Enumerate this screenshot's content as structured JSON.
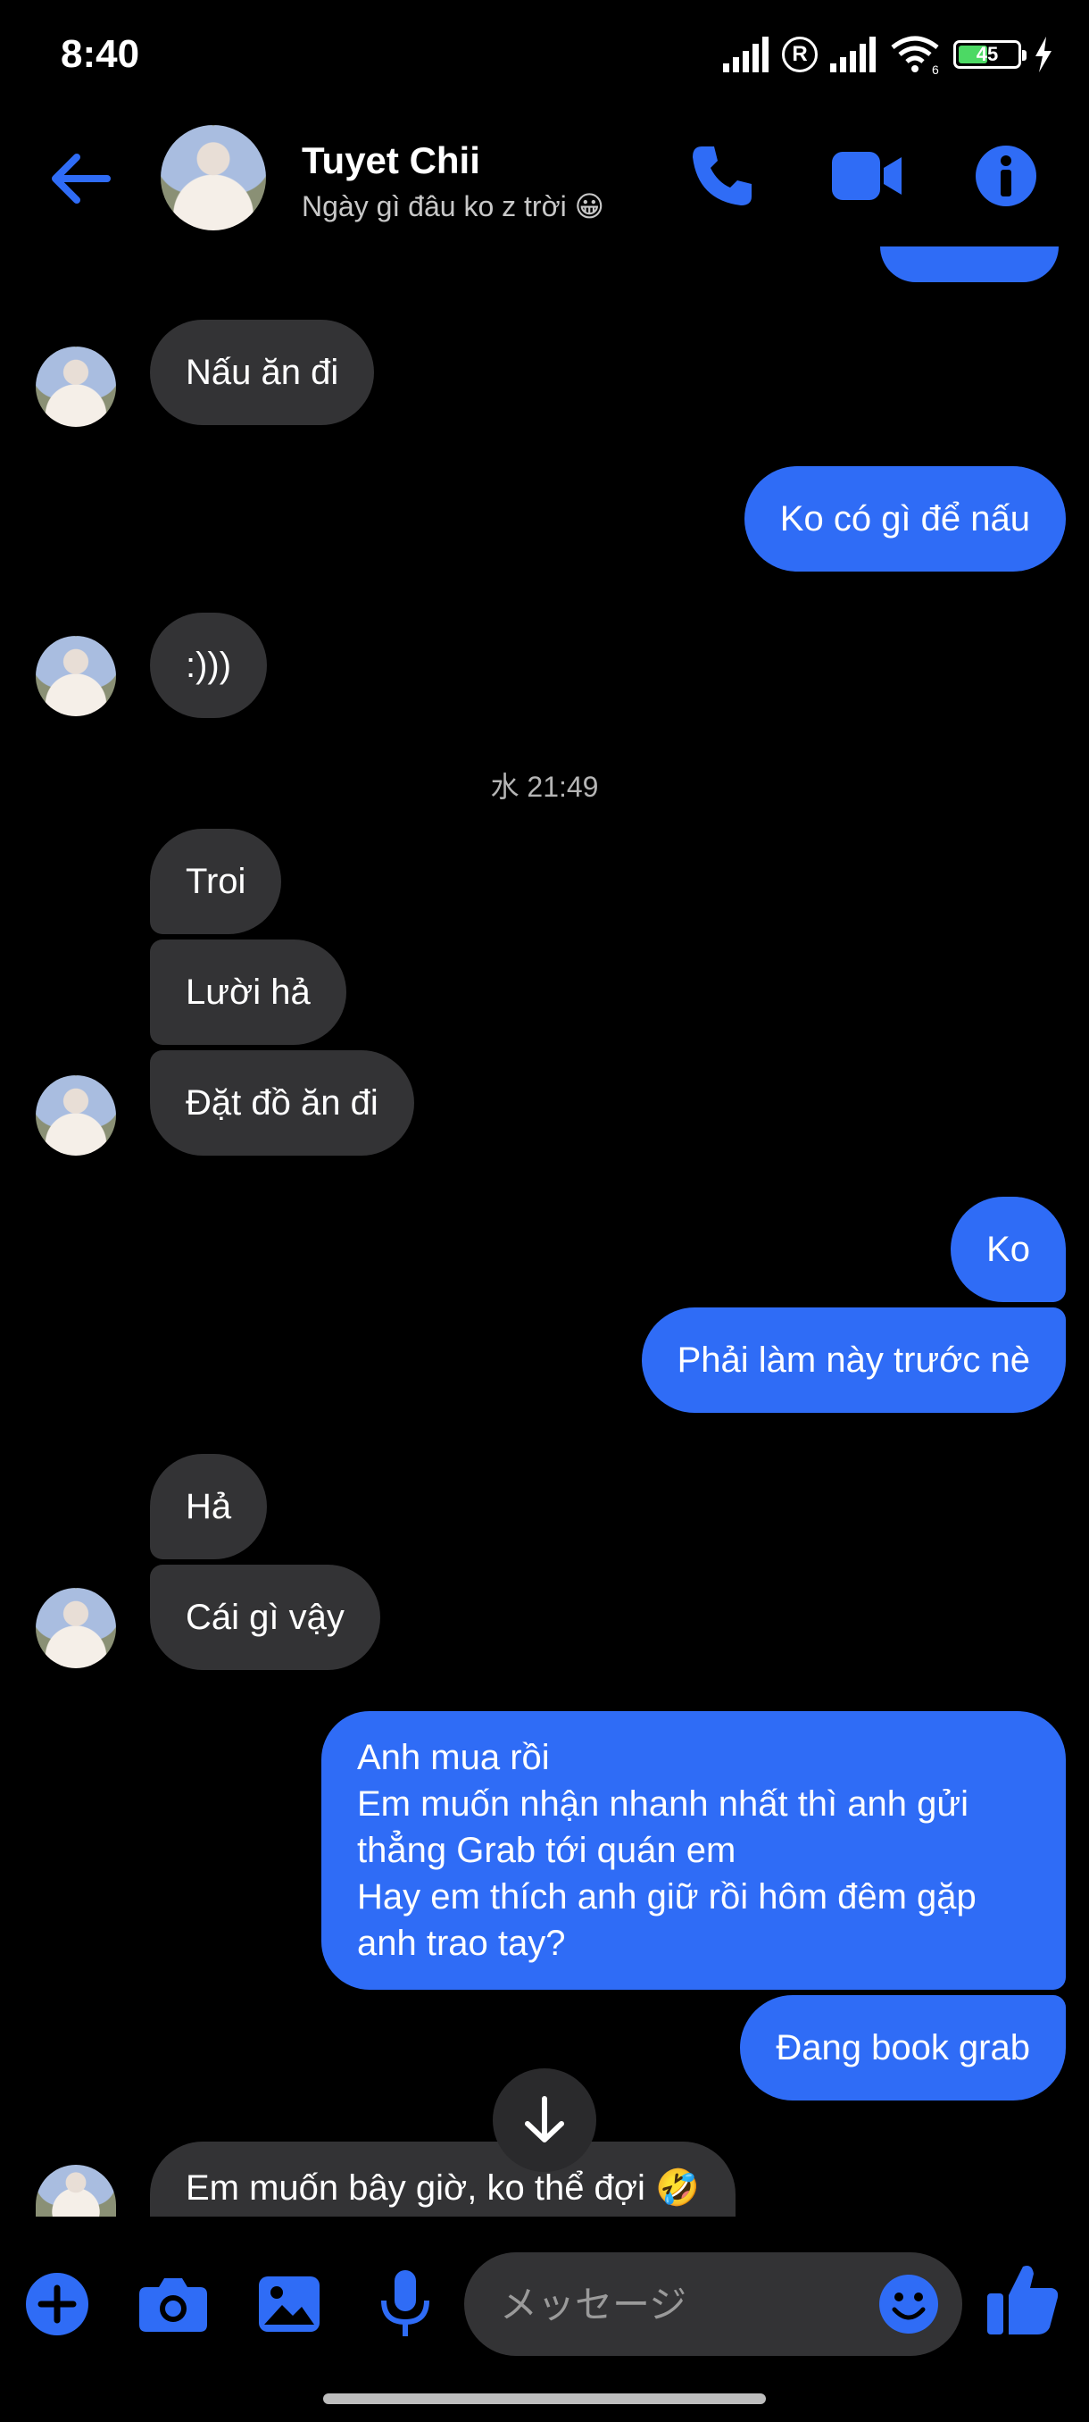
{
  "status_bar": {
    "time": "8:40",
    "battery": "45",
    "icons": [
      "signal-icon",
      "registered-icon",
      "signal-icon",
      "wifi-icon",
      "battery-icon",
      "charging-icon"
    ]
  },
  "header": {
    "name": "Tuyet Chii",
    "status": "Ngày gì đâu ko z trời 😀"
  },
  "timestamp": "水 21:49",
  "messages": {
    "m1": "Nấu ăn đi",
    "m2": "Ko có gì để nấu",
    "m3": ":)))",
    "m4": "Troi",
    "m5": "Lười hả",
    "m6": "Đặt đồ ăn đi",
    "m7": "Ko",
    "m8": "Phải làm này trước nè",
    "m9": "Hả",
    "m10": "Cái gì vậy",
    "m11_lines": [
      "Anh mua rồi",
      "Em muốn nhận nhanh nhất thì anh gửi thẳng Grab tới quán em",
      "Hay em thích anh giữ rồi hôm đêm gặp anh trao tay?"
    ],
    "m12": "Đang book grab",
    "m13": "Em muốn bây giờ, ko thể đợi 🤣"
  },
  "composer": {
    "placeholder": "メッセージ"
  },
  "colors": {
    "accent": "#2f6cf6",
    "incoming_bubble": "#333335",
    "background": "#000000"
  }
}
